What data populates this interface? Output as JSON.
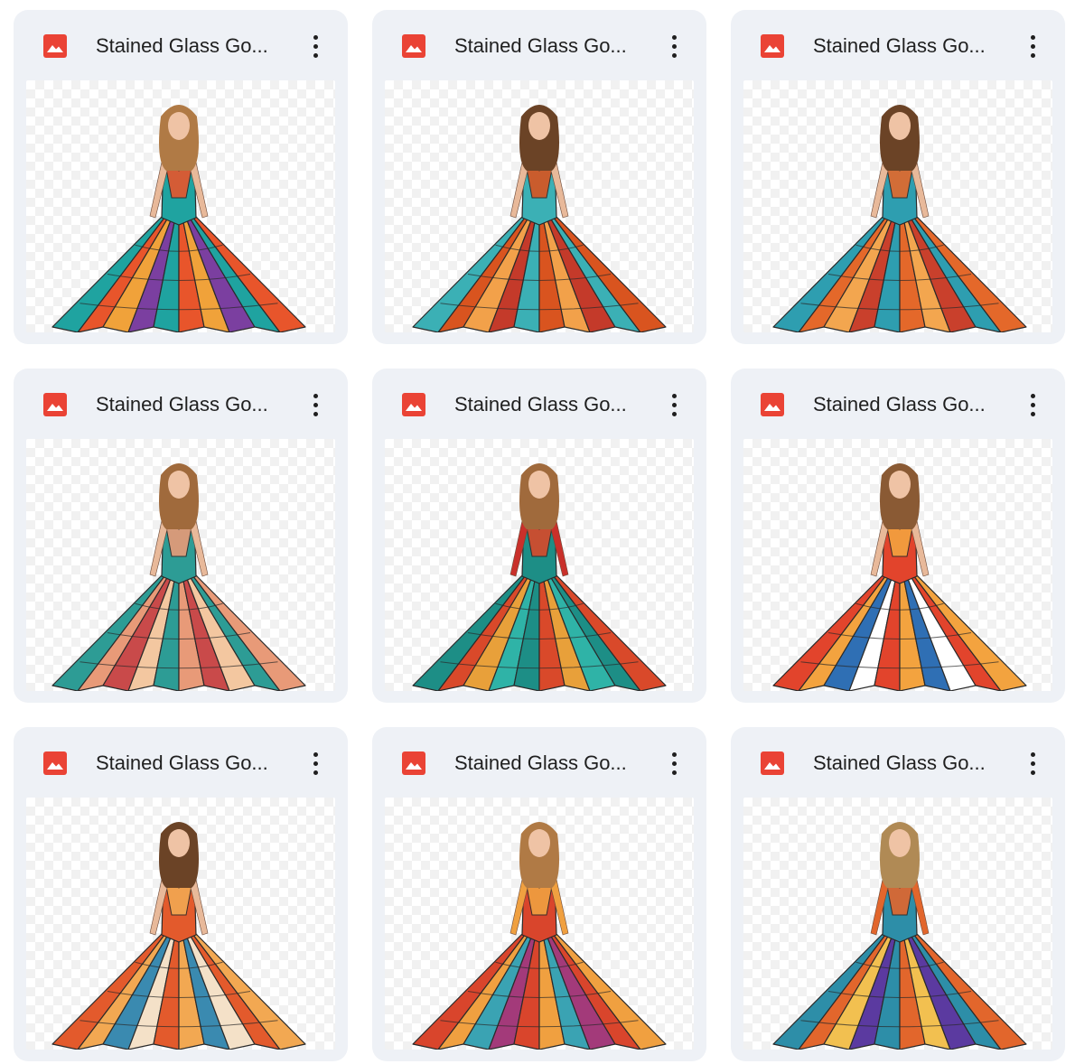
{
  "files": [
    {
      "title": "Stained Glass Go...",
      "icon": "image-file-icon",
      "palette": [
        "#1fa3a0",
        "#e8552b",
        "#f0a23a",
        "#7b3fa0"
      ],
      "sleeves": "none",
      "hair": "#b07a45"
    },
    {
      "title": "Stained Glass Go...",
      "icon": "image-file-icon",
      "palette": [
        "#3bb0b5",
        "#d9541f",
        "#f2a14a",
        "#c43a2a"
      ],
      "sleeves": "none",
      "hair": "#6b4326"
    },
    {
      "title": "Stained Glass Go...",
      "icon": "image-file-icon",
      "palette": [
        "#2e9eb0",
        "#e4682a",
        "#f3a64f",
        "#c9402c"
      ],
      "sleeves": "none",
      "hair": "#6b4326"
    },
    {
      "title": "Stained Glass Go...",
      "icon": "image-file-icon",
      "palette": [
        "#2d9c95",
        "#e89a78",
        "#c94a4a",
        "#f3c7a0"
      ],
      "sleeves": "short",
      "hair": "#a06a3c"
    },
    {
      "title": "Stained Glass Go...",
      "icon": "image-file-icon",
      "palette": [
        "#1d8e86",
        "#d9492a",
        "#e8a03a",
        "#2fb3a7"
      ],
      "sleeves": "long-red",
      "hair": "#a06a3c"
    },
    {
      "title": "Stained Glass Go...",
      "icon": "image-file-icon",
      "palette": [
        "#e2442c",
        "#f3a33f",
        "#2f6fb4",
        "#ffffff"
      ],
      "sleeves": "none",
      "hair": "#8a5a34"
    },
    {
      "title": "Stained Glass Go...",
      "icon": "image-file-icon",
      "palette": [
        "#e35a2c",
        "#f2a852",
        "#3a8ab0",
        "#f4e1c8"
      ],
      "sleeves": "none",
      "hair": "#6b4326"
    },
    {
      "title": "Stained Glass Go...",
      "icon": "image-file-icon",
      "palette": [
        "#d9452c",
        "#f0a040",
        "#3aa3b3",
        "#a33a7a"
      ],
      "sleeves": "long",
      "hair": "#b07a45"
    },
    {
      "title": "Stained Glass Go...",
      "icon": "image-file-icon",
      "palette": [
        "#2d8ea8",
        "#e2662c",
        "#f2c050",
        "#5b3aa0"
      ],
      "sleeves": "long",
      "hair": "#b08a55"
    }
  ],
  "colors": {
    "card_bg": "#eef1f6",
    "icon_red": "#ea4335",
    "title_text": "#1f1f1f"
  }
}
